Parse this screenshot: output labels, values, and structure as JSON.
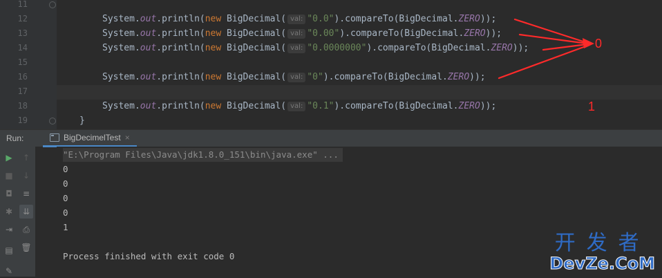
{
  "editor": {
    "line_numbers": [
      "11",
      "12",
      "13",
      "14",
      "15",
      "16",
      "17",
      "18",
      "19"
    ],
    "lines": [
      {
        "indent": "System.",
        "out": "out",
        "mid": ".println(",
        "kw": "new",
        "cls": " BigDecimal(",
        "hint": "val:",
        "str": "\"0.0\"",
        "tail": ").compareTo(BigDecimal.",
        "const": "ZERO",
        "end": "));"
      },
      {
        "indent": "System.",
        "out": "out",
        "mid": ".println(",
        "kw": "new",
        "cls": " BigDecimal(",
        "hint": "val:",
        "str": "\"0.00\"",
        "tail": ").compareTo(BigDecimal.",
        "const": "ZERO",
        "end": "));"
      },
      {
        "indent": "System.",
        "out": "out",
        "mid": ".println(",
        "kw": "new",
        "cls": " BigDecimal(",
        "hint": "val:",
        "str": "\"0.0000000\"",
        "tail": ").compareTo(BigDecimal.",
        "const": "ZERO",
        "end": "));"
      },
      {
        "indent": "System.",
        "out": "out",
        "mid": ".println(",
        "kw": "new",
        "cls": " BigDecimal(",
        "hint": "val:",
        "str": "\"0\"",
        "tail": ").compareTo(BigDecimal.",
        "const": "ZERO",
        "end": "));"
      },
      {
        "indent": "System.",
        "out": "out",
        "mid": ".println(",
        "kw": "new",
        "cls": " BigDecimal(",
        "hint": "val:",
        "str": "\"0.1\"",
        "tail": ").compareTo(BigDecimal.",
        "const": "ZERO",
        "end": "));"
      }
    ],
    "closing_brace": "}",
    "annotation_zero": "0",
    "annotation_one": "1"
  },
  "run_panel": {
    "label": "Run:",
    "tab_title": "BigDecimelTest",
    "tab_close": "×",
    "icons": [
      "run-icon",
      "stop-icon",
      "camera-icon",
      "debug-icon",
      "exit-icon",
      "layout-icon",
      "pin-icon",
      "up-arrow-icon",
      "down-arrow-icon",
      "soft-wrap-icon",
      "scroll-to-end-icon",
      "print-icon",
      "trash-icon"
    ],
    "console": {
      "command": "\"E:\\Program Files\\Java\\jdk1.8.0_151\\bin\\java.exe\" ...",
      "outputs": [
        "0",
        "0",
        "0",
        "0",
        "1"
      ],
      "finish": "Process finished with exit code 0"
    }
  },
  "watermark": {
    "top": "开发者",
    "bottom": "DevZe.CoM"
  },
  "colors": {
    "annotation": "#ff2a2a",
    "accent": "#4a88c7",
    "watermark": "#2f6bc5"
  }
}
